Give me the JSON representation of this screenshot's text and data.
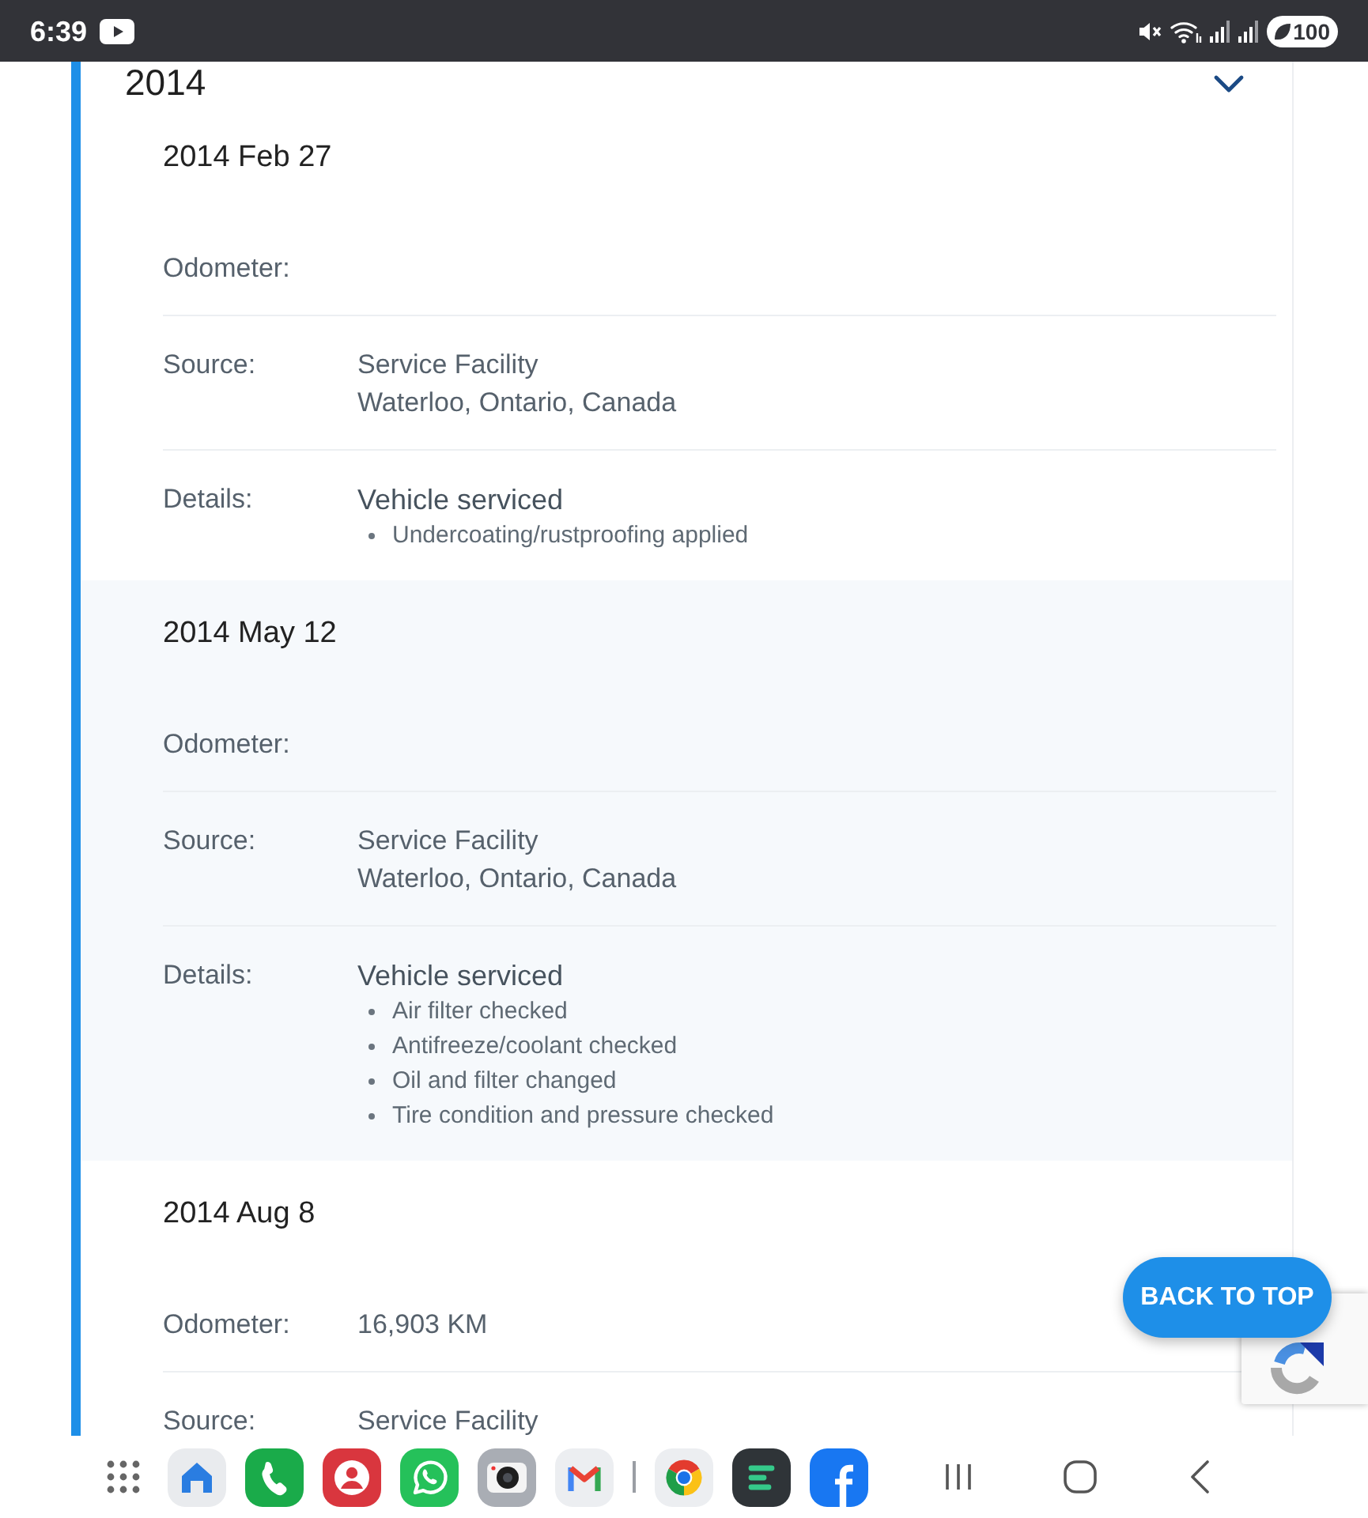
{
  "status_bar": {
    "time": "6:39",
    "battery": "100"
  },
  "section": {
    "year": "2014",
    "expanded": true,
    "entries": [
      {
        "date": "2014 Feb 27",
        "rows": [
          {
            "kind": "text",
            "label": "Odometer:"
          },
          {
            "kind": "text",
            "label": "Source:",
            "lines": [
              "Service Facility",
              "Waterloo, Ontario, Canada"
            ]
          },
          {
            "kind": "details",
            "label": "Details:",
            "title": "Vehicle serviced",
            "bullets": [
              "Undercoating/rustproofing applied"
            ]
          }
        ]
      },
      {
        "date": "2014 May 12",
        "rows": [
          {
            "kind": "text",
            "label": "Odometer:"
          },
          {
            "kind": "text",
            "label": "Source:",
            "lines": [
              "Service Facility",
              "Waterloo, Ontario, Canada"
            ]
          },
          {
            "kind": "details",
            "label": "Details:",
            "title": "Vehicle serviced",
            "bullets": [
              "Air filter checked",
              "Antifreeze/coolant checked",
              "Oil and filter changed",
              "Tire condition and pressure checked"
            ]
          }
        ]
      },
      {
        "date": "2014 Aug 8",
        "rows": [
          {
            "kind": "text",
            "label": "Odometer:",
            "lines": [
              "16,903 KM"
            ]
          },
          {
            "kind": "text",
            "label": "Source:",
            "lines": [
              "Service Facility"
            ]
          }
        ]
      }
    ]
  },
  "back_to_top": "BACK TO TOP"
}
